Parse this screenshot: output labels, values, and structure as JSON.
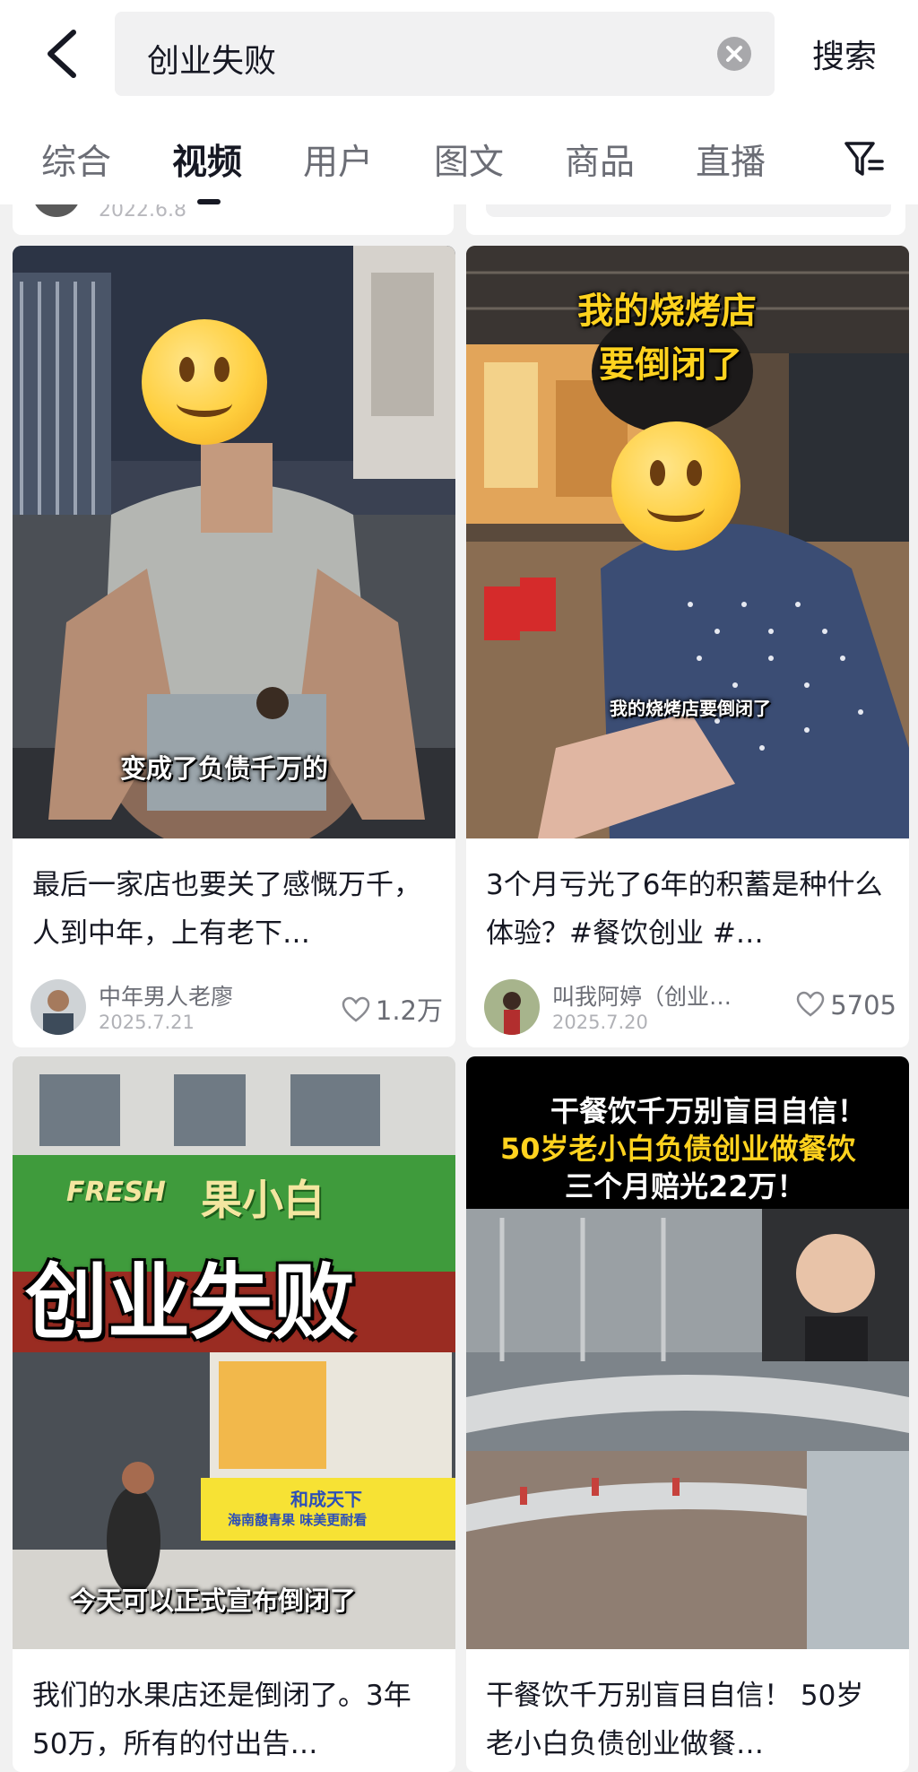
{
  "search": {
    "query": "创业失败",
    "button_label": "搜索"
  },
  "tabs": [
    {
      "label": "综合"
    },
    {
      "label": "视频"
    },
    {
      "label": "用户"
    },
    {
      "label": "图文"
    },
    {
      "label": "商品"
    },
    {
      "label": "直播"
    }
  ],
  "active_tab": "视频",
  "previous_row": {
    "date": "2022.6.8"
  },
  "cards": [
    {
      "title": "最后一家店也要关了感慨万千，人到中年，上有老下…",
      "caption": "变成了负债千万的",
      "author": "中年男人老廖",
      "date": "2025.7.21",
      "likes": "1.2万"
    },
    {
      "title": "3个月亏光了6年的积蓄是种什么体验？#餐饮创业 #…",
      "caption_top_1": "我的烧烤店",
      "caption_top_2": "要倒闭了",
      "caption": "我的烧烤店要倒闭了",
      "author": "叫我阿婷（创业…",
      "date": "2025.7.20",
      "likes": "5705"
    },
    {
      "title": "我们的水果店还是倒闭了。3年50万，所有的付出告…",
      "sign_brand": "FRESH",
      "sign_name": "果小白",
      "headline": "创业失败",
      "banner": "和成天下",
      "banner_2": "海南馥青果 味美更耐看",
      "caption": "今天可以正式宣布倒闭了"
    },
    {
      "title": "干餐饮千万别盲目自信！ 50岁老小白负债创业做餐…",
      "banner_line_1": "干餐饮千万别盲目自信！",
      "banner_line_2": "50岁老小白负债创业做餐饮",
      "banner_line_3": "三个月赔光22万！"
    }
  ],
  "colors": {
    "page_bg": "#f1f1f1",
    "card_bg": "#ffffff",
    "text_primary": "#161823",
    "text_secondary": "#6b6d75",
    "overlay_yellow": "#ffd21e"
  },
  "icons": [
    "back-arrow-icon",
    "clear-icon",
    "filter-icon",
    "heart-icon"
  ]
}
